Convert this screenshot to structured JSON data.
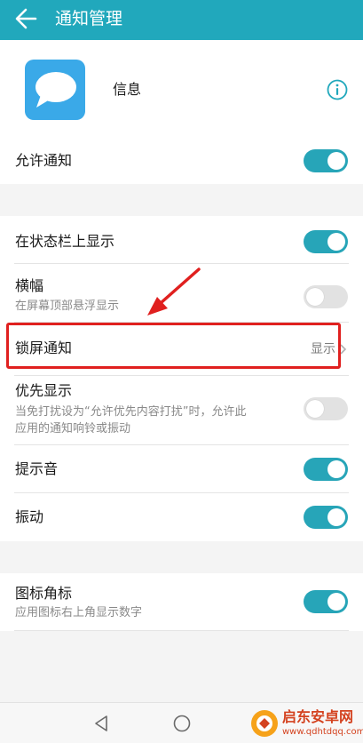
{
  "header": {
    "title": "通知管理"
  },
  "app": {
    "name": "信息"
  },
  "settings": {
    "allow_notifications": {
      "label": "允许通知",
      "enabled": true
    },
    "status_bar": {
      "label": "在状态栏上显示",
      "enabled": true
    },
    "banner": {
      "label": "横幅",
      "sub": "在屏幕顶部悬浮显示",
      "enabled": false
    },
    "lock_screen": {
      "label": "锁屏通知",
      "value": "显示"
    },
    "priority": {
      "label": "优先显示",
      "sub_line1": "当免打扰设为“允许优先内容打扰”时，允许此",
      "sub_line2": "应用的通知响铃或振动",
      "enabled": false
    },
    "sound": {
      "label": "提示音",
      "enabled": true
    },
    "vibrate": {
      "label": "振动",
      "enabled": true
    },
    "badge": {
      "label": "图标角标",
      "sub": "应用图标右上角显示数字",
      "enabled": true
    }
  },
  "watermark": {
    "title": "启东安卓网",
    "url": "www.qdhtdqq.com"
  },
  "colors": {
    "header": "#21a8bc",
    "toggle_on": "#27a5b8",
    "highlight": "#e0201f"
  }
}
